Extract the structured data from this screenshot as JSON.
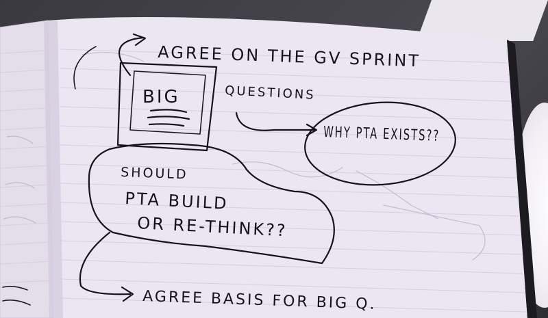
{
  "notes": {
    "title": "AGREE ON THE GV SPRINT",
    "box_label": "BIG",
    "questions_label": "QUESTIONS",
    "question_1": "WHY PTA EXISTS??",
    "question_2_line_1": "SHOULD",
    "question_2_line_2": "PTA BUILD",
    "question_2_line_3": "OR RE-THINK??",
    "footer": "AGREE BASIS FOR BIG Q."
  },
  "colors": {
    "paper": "#e8e2ef",
    "ink": "#16131c"
  }
}
